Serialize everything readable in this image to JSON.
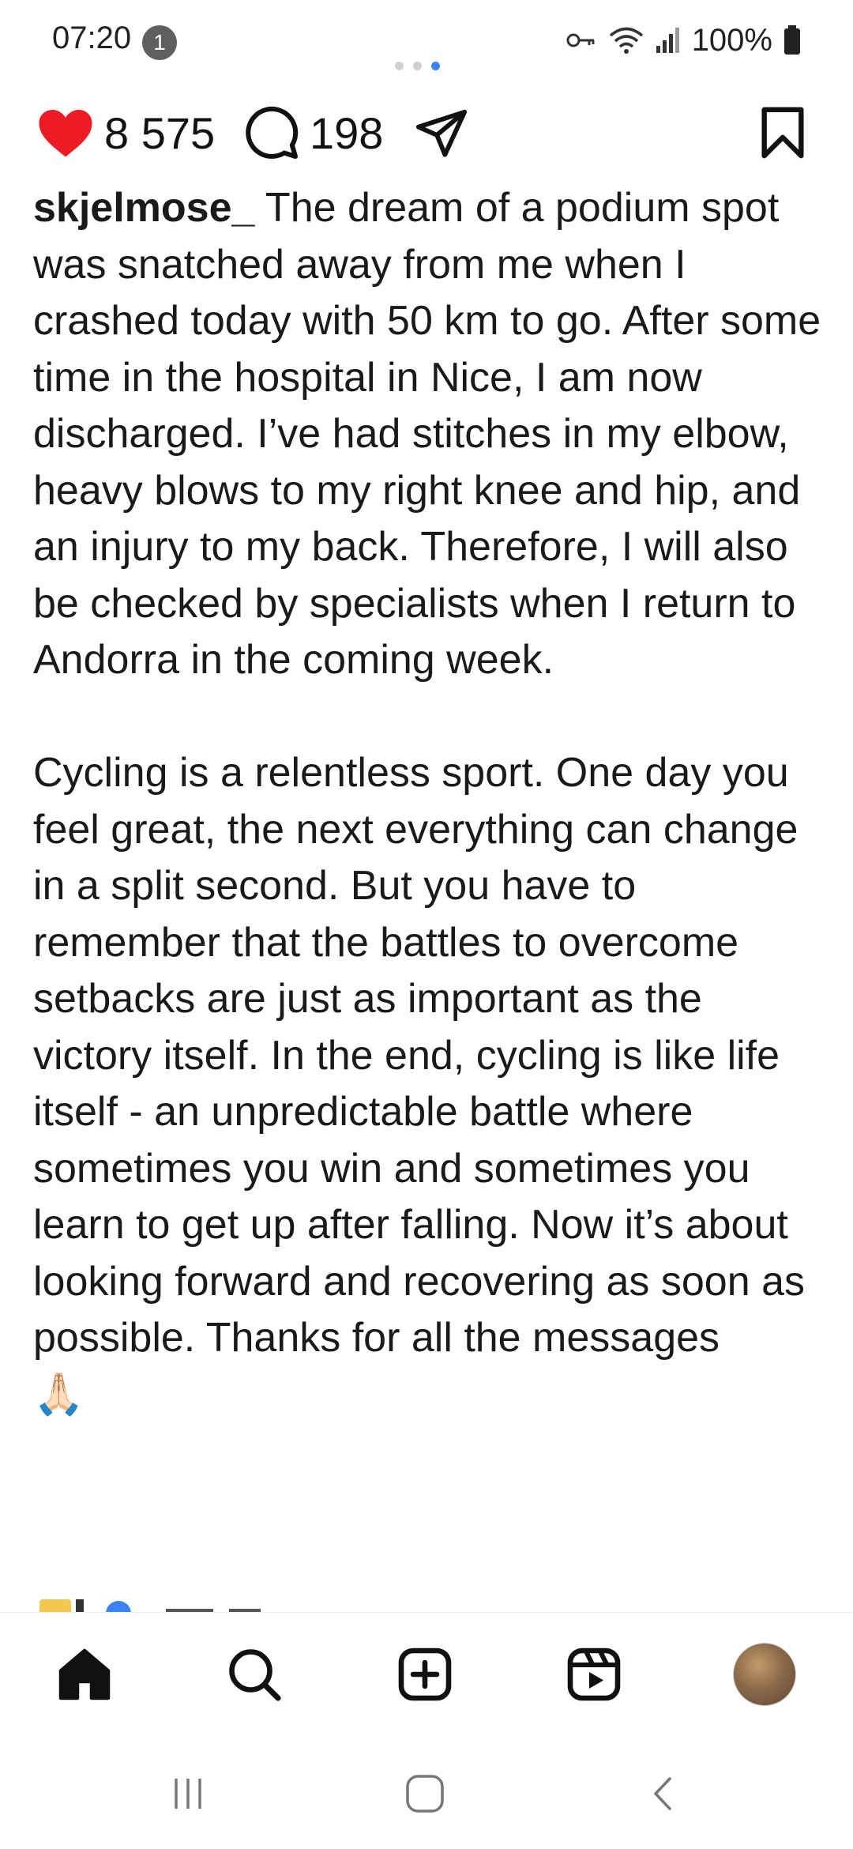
{
  "status_bar": {
    "time": "07:20",
    "notification_count": "1",
    "battery": "100%"
  },
  "carousel": {
    "dots": 3,
    "active_index": 2
  },
  "actions": {
    "likes": "8 575",
    "comments": "198"
  },
  "caption": {
    "username": "skjelmose_",
    "text": " The dream of a podium spot was snatched away from me when I crashed today with 50 km to go. After some time in the hospital in Nice, I am now discharged. I’ve had stitches in my elbow, heavy blows to my right knee and hip, and an injury to my back. Therefore, I will also be checked by specialists when I return to Andorra in the coming week.\n\nCycling is a relentless sport. One day you feel great, the next everything can change in a split second. But you have to remember that the battles to overcome setbacks are just as important as the victory itself. In the end, cycling is like life itself - an unpredictable battle where sometimes you win and sometimes you learn to get up after falling. Now it’s about looking forward and recovering as soon as possible. Thanks for all the messages\n🙏🏻"
  },
  "bottom_nav": [
    "home-icon",
    "search-icon",
    "create-icon",
    "reels-icon",
    "profile-avatar"
  ],
  "colors": {
    "like": "#ed1c24",
    "accent": "#3b82f6",
    "text": "#111111"
  }
}
